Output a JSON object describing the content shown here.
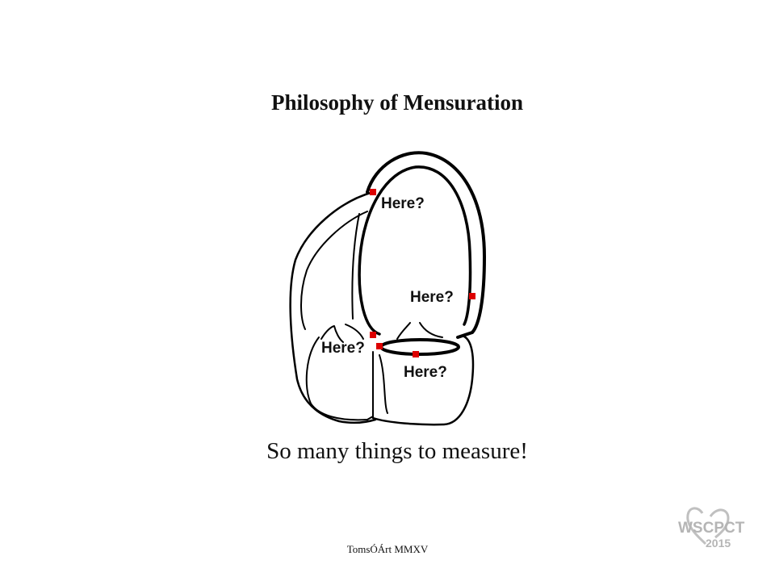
{
  "slide": {
    "title": "Philosophy of Mensuration",
    "caption": "So many things to measure!",
    "credit": "TomsÓÁrt  MMXV"
  },
  "diagram": {
    "labels": [
      "Here?",
      "Here?",
      "Here?",
      "Here?"
    ],
    "marker_color": "#dd0000",
    "line_color": "#000000"
  },
  "logo": {
    "text_top": "WSCPCT",
    "text_bottom": "2015",
    "color": "#b5b5b5"
  }
}
